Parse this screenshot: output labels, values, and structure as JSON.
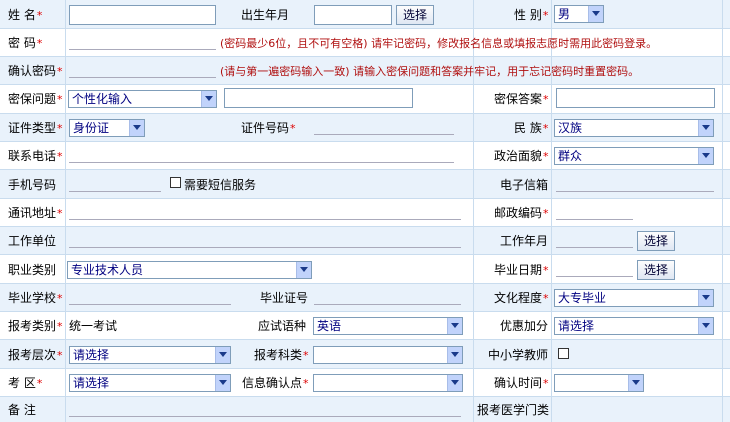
{
  "row1": {
    "name_label": "姓 名",
    "name_req": "*",
    "name_value": "",
    "birth_label": "出生年月",
    "birth_value": "",
    "birth_button": "选择",
    "gender_label": "性 别",
    "gender_req": "*",
    "gender_value": "男"
  },
  "row2": {
    "password_label": "密 码",
    "password_req": "*",
    "password_value": "",
    "password_hint": "(密码最少6位，且不可有空格) 请牢记密码，修改报名信息或填报志愿时需用此密码登录。"
  },
  "row3": {
    "confirm_label": "确认密码",
    "confirm_req": "*",
    "confirm_value": "",
    "confirm_hint": "(请与第一遍密码输入一致) 请输入密保问题和答案并牢记，用于忘记密码时重置密码。"
  },
  "row4": {
    "question_label": "密保问题",
    "question_req": "*",
    "question_value": "个性化输入",
    "question_custom_value": "",
    "answer_label": "密保答案",
    "answer_req": "*",
    "answer_value": ""
  },
  "row5": {
    "idtype_label": "证件类型",
    "idtype_req": "*",
    "idtype_value": "身份证",
    "idno_label": "证件号码",
    "idno_req": "*",
    "idno_value": "",
    "nation_label": "民 族",
    "nation_req": "*",
    "nation_value": "汉族"
  },
  "row6": {
    "phone_label": "联系电话",
    "phone_req": "*",
    "phone_value": "",
    "political_label": "政治面貌",
    "political_req": "*",
    "political_value": "群众"
  },
  "row7": {
    "mobile_label": "手机号码",
    "mobile_value": "",
    "sms_label": "需要短信服务",
    "email_label": "电子信箱",
    "email_value": ""
  },
  "row8": {
    "address_label": "通讯地址",
    "address_req": "*",
    "address_value": "",
    "zip_label": "邮政编码",
    "zip_req": "*",
    "zip_value": ""
  },
  "row9": {
    "work_label": "工作单位",
    "work_value": "",
    "workyear_label": "工作年月",
    "workyear_value": "",
    "workyear_button": "选择"
  },
  "row10": {
    "job_label": "职业类别",
    "job_value": "专业技术人员",
    "grad_date_label": "毕业日期",
    "grad_date_req": "*",
    "grad_date_value": "",
    "grad_date_button": "选择"
  },
  "row11": {
    "school_label": "毕业学校",
    "school_req": "*",
    "school_value": "",
    "cert_label": "毕业证号",
    "cert_value": "",
    "edu_label": "文化程度",
    "edu_req": "*",
    "edu_value": "大专毕业"
  },
  "row12": {
    "examtype_label": "报考类别",
    "examtype_req": "*",
    "examtype_value": "统一考试",
    "lang_label": "应试语种",
    "lang_value": "英语",
    "bonus_label": "优惠加分",
    "bonus_value": "请选择"
  },
  "row13": {
    "level_label": "报考层次",
    "level_req": "*",
    "level_value": "请选择",
    "subject_label": "报考科类",
    "subject_req": "*",
    "subject_value": "",
    "teacher_label": "中小学教师"
  },
  "row14": {
    "district_label": "考 区",
    "district_req": "*",
    "district_value": "请选择",
    "confirm_point_label": "信息确认点",
    "confirm_point_req": "*",
    "confirm_point_value": "",
    "confirm_time_label": "确认时间",
    "confirm_time_req": "*",
    "confirm_time_value": ""
  },
  "row15": {
    "remark_label": "备 注",
    "remark_value": "",
    "medical_label": "报考医学门类"
  },
  "colors": {
    "row_alt": "#e9f2fb",
    "grid": "#c9dcee",
    "required": "#d00000",
    "hint": "#b01010",
    "select_text": "#000080"
  }
}
